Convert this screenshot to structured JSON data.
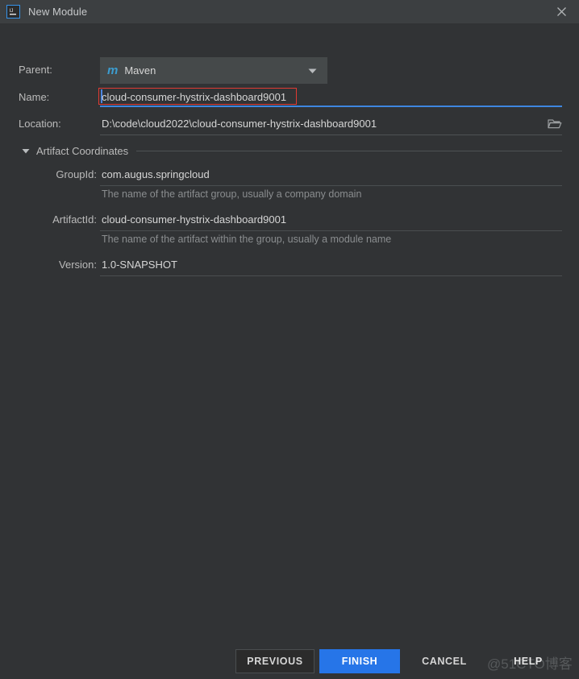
{
  "window": {
    "title": "New Module",
    "app_icon": "intellij-idea-icon",
    "close_icon": "close-icon"
  },
  "form": {
    "parent": {
      "label": "Parent:",
      "value": "Maven",
      "icon": "maven-icon",
      "dropdown_icon": "chevron-down-icon"
    },
    "name": {
      "label": "Name:",
      "value": "cloud-consumer-hystrix-dashboard9001",
      "focused": true,
      "highlight_color": "#E03A33",
      "focus_color": "#3E86E0"
    },
    "location": {
      "label": "Location:",
      "value": "D:\\code\\cloud2022\\cloud-consumer-hystrix-dashboard9001",
      "browse_icon": "folder-icon"
    }
  },
  "artifact_coordinates": {
    "section_title": "Artifact Coordinates",
    "expanded": true,
    "expander_icon": "triangle-down-icon",
    "fields": [
      {
        "label": "GroupId:",
        "value": "com.augus.springcloud",
        "hint": "The name of the artifact group, usually a company domain"
      },
      {
        "label": "ArtifactId:",
        "value": "cloud-consumer-hystrix-dashboard9001",
        "hint": "The name of the artifact within the group, usually a module name"
      },
      {
        "label": "Version:",
        "value": "1.0-SNAPSHOT",
        "hint": ""
      }
    ]
  },
  "buttons": {
    "previous": "PREVIOUS",
    "finish": "FINISH",
    "cancel": "CANCEL",
    "help": "HELP",
    "finish_color": "#2675E8"
  },
  "watermark": {
    "text": "@51CTO博客"
  }
}
